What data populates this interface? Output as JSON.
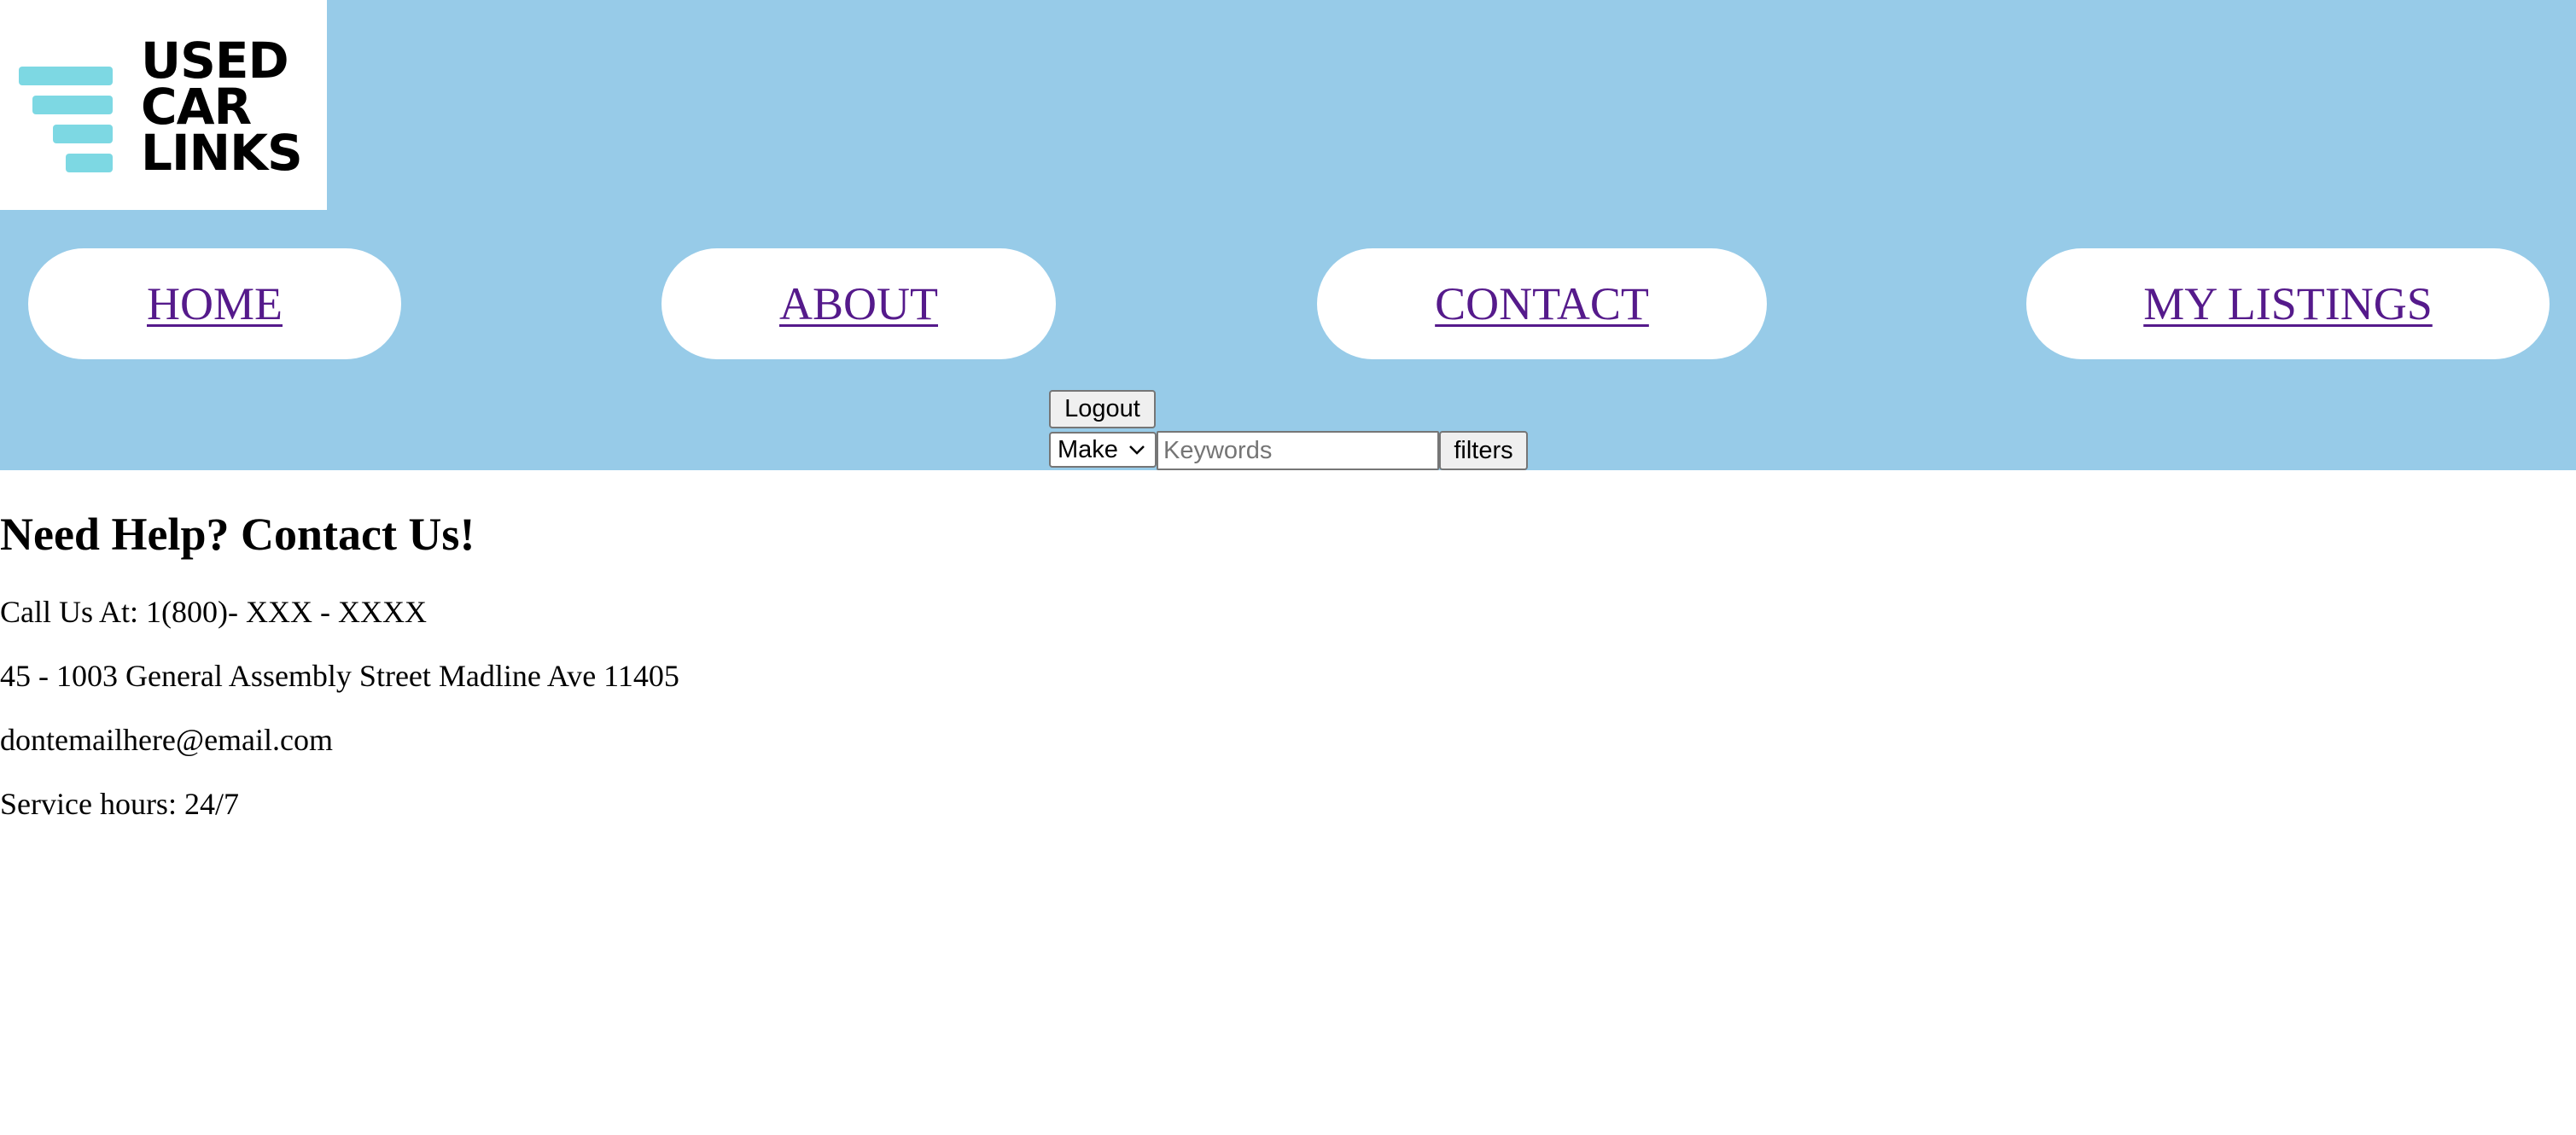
{
  "logo": {
    "lines": [
      "USED",
      "CAR",
      "LINKS"
    ],
    "bar_color": "#7dd8e3"
  },
  "nav": {
    "items": [
      {
        "label": "HOME"
      },
      {
        "label": "ABOUT"
      },
      {
        "label": "CONTACT"
      },
      {
        "label": "MY LISTINGS"
      }
    ],
    "link_color": "#551a8b"
  },
  "header": {
    "background": "#97cbe8",
    "logout_label": "Logout"
  },
  "search": {
    "make_selected": "Make",
    "keywords_value": "",
    "keywords_placeholder": "Keywords",
    "filters_label": "filters"
  },
  "contact": {
    "heading": "Need Help? Contact Us!",
    "phone": "Call Us At: 1(800)- XXX - XXXX",
    "address": "45 - 1003 General Assembly Street Madline Ave 11405",
    "email": "dontemailhere@email.com",
    "hours": "Service hours: 24/7"
  }
}
